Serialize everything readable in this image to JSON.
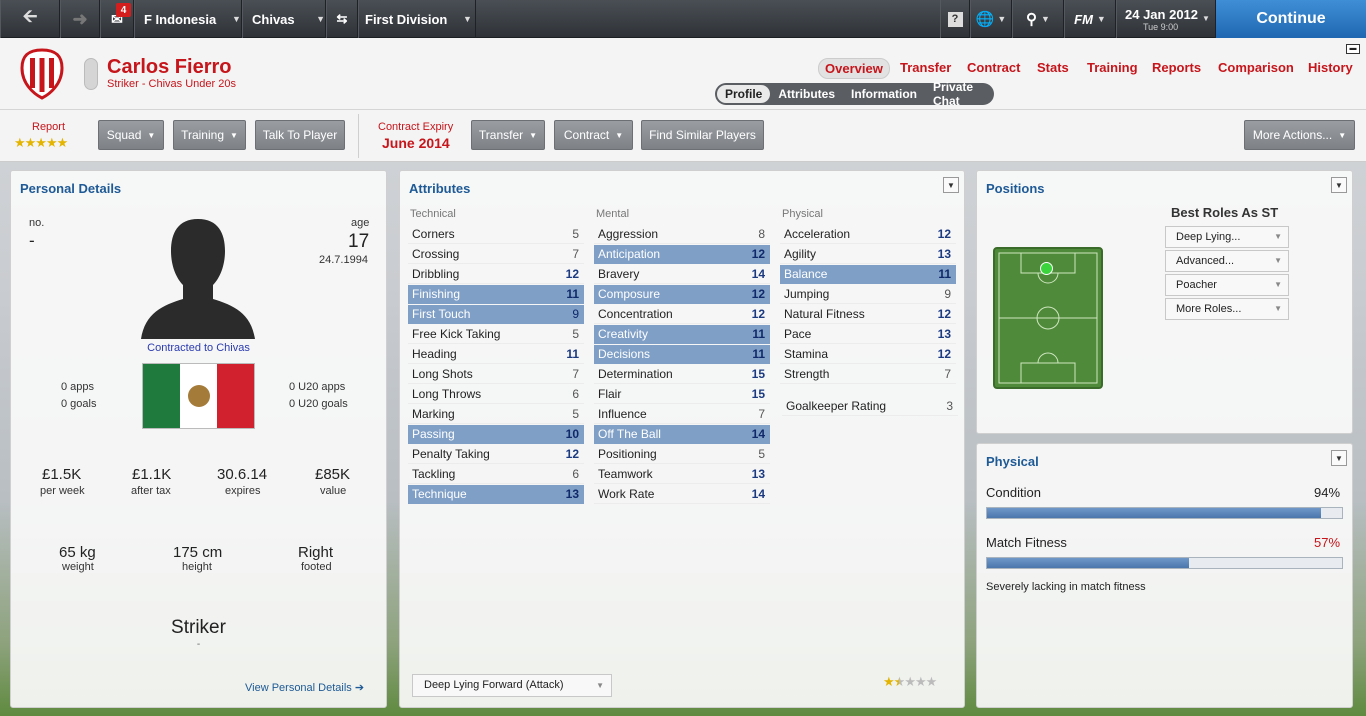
{
  "topbar": {
    "mail_count": "4",
    "nation": "F Indonesia",
    "club": "Chivas",
    "competition": "First Division",
    "date": "24 Jan 2012",
    "day_time": "Tue 9:00",
    "fm_label": "FM",
    "continue_label": "Continue",
    "help_label": "?"
  },
  "header": {
    "name": "Carlos Fierro",
    "subtitle": "Striker - Chivas Under 20s",
    "nav": [
      "Overview",
      "Transfer",
      "Contract",
      "Stats",
      "Training",
      "Reports",
      "Comparison",
      "History"
    ],
    "subnav": [
      "Profile",
      "Attributes",
      "Information",
      "Private Chat"
    ]
  },
  "actionbar": {
    "report_label": "Report",
    "report_stars": "★★★★★",
    "squad": "Squad",
    "training": "Training",
    "talk": "Talk To Player",
    "contract_expiry_label": "Contract Expiry",
    "contract_expiry_value": "June 2014",
    "transfer": "Transfer",
    "contract": "Contract",
    "similar": "Find Similar Players",
    "more": "More Actions..."
  },
  "personal": {
    "title": "Personal Details",
    "no_label": "no.",
    "no_value": "-",
    "age_label": "age",
    "age_value": "17",
    "dob": "24.7.1994",
    "contracted": "Contracted to Chivas",
    "apps": "0 apps",
    "goals": "0 goals",
    "u20_apps": "0 U20 apps",
    "u20_goals": "0 U20 goals",
    "wage": "£1.5K",
    "wage_label": "per week",
    "after_tax": "£1.1K",
    "after_tax_label": "after tax",
    "expires": "30.6.14",
    "expires_label": "expires",
    "value": "£85K",
    "value_label": "value",
    "weight": "65 kg",
    "weight_label": "weight",
    "height": "175 cm",
    "height_label": "height",
    "foot": "Right",
    "foot_label": "footed",
    "position": "Striker",
    "position_sub": "-",
    "view_link": "View Personal Details ➔"
  },
  "attributes": {
    "title": "Attributes",
    "technical_label": "Technical",
    "mental_label": "Mental",
    "physical_label": "Physical",
    "technical": [
      {
        "n": "Corners",
        "v": "5",
        "hl": false
      },
      {
        "n": "Crossing",
        "v": "7",
        "hl": false
      },
      {
        "n": "Dribbling",
        "v": "12",
        "hl": false
      },
      {
        "n": "Finishing",
        "v": "11",
        "hl": true
      },
      {
        "n": "First Touch",
        "v": "9",
        "hl": true
      },
      {
        "n": "Free Kick Taking",
        "v": "5",
        "hl": false
      },
      {
        "n": "Heading",
        "v": "11",
        "hl": false
      },
      {
        "n": "Long Shots",
        "v": "7",
        "hl": false
      },
      {
        "n": "Long Throws",
        "v": "6",
        "hl": false
      },
      {
        "n": "Marking",
        "v": "5",
        "hl": false
      },
      {
        "n": "Passing",
        "v": "10",
        "hl": true
      },
      {
        "n": "Penalty Taking",
        "v": "12",
        "hl": false
      },
      {
        "n": "Tackling",
        "v": "6",
        "hl": false
      },
      {
        "n": "Technique",
        "v": "13",
        "hl": true
      }
    ],
    "mental": [
      {
        "n": "Aggression",
        "v": "8",
        "hl": false
      },
      {
        "n": "Anticipation",
        "v": "12",
        "hl": true
      },
      {
        "n": "Bravery",
        "v": "14",
        "hl": false
      },
      {
        "n": "Composure",
        "v": "12",
        "hl": true
      },
      {
        "n": "Concentration",
        "v": "12",
        "hl": false
      },
      {
        "n": "Creativity",
        "v": "11",
        "hl": true
      },
      {
        "n": "Decisions",
        "v": "11",
        "hl": true
      },
      {
        "n": "Determination",
        "v": "15",
        "hl": false
      },
      {
        "n": "Flair",
        "v": "15",
        "hl": false
      },
      {
        "n": "Influence",
        "v": "7",
        "hl": false
      },
      {
        "n": "Off The Ball",
        "v": "14",
        "hl": true
      },
      {
        "n": "Positioning",
        "v": "5",
        "hl": false
      },
      {
        "n": "Teamwork",
        "v": "13",
        "hl": false
      },
      {
        "n": "Work Rate",
        "v": "14",
        "hl": false
      }
    ],
    "physical": [
      {
        "n": "Acceleration",
        "v": "12",
        "hl": false
      },
      {
        "n": "Agility",
        "v": "13",
        "hl": false
      },
      {
        "n": "Balance",
        "v": "11",
        "hl": true
      },
      {
        "n": "Jumping",
        "v": "9",
        "hl": false
      },
      {
        "n": "Natural Fitness",
        "v": "12",
        "hl": false
      },
      {
        "n": "Pace",
        "v": "13",
        "hl": false
      },
      {
        "n": "Stamina",
        "v": "12",
        "hl": false
      },
      {
        "n": "Strength",
        "v": "7",
        "hl": false
      }
    ],
    "gk_label": "Goalkeeper Rating",
    "gk_value": "3",
    "role_select": "Deep Lying Forward (Attack)",
    "role_stars": 1.5
  },
  "positions": {
    "title": "Positions",
    "best_roles": "Best Roles As ST",
    "roles": [
      "Deep Lying...",
      "Advanced...",
      "Poacher",
      "More Roles..."
    ]
  },
  "physical": {
    "title": "Physical",
    "condition_label": "Condition",
    "condition_value": "94%",
    "condition_pct": 94,
    "fitness_label": "Match Fitness",
    "fitness_value": "57%",
    "fitness_pct": 57,
    "note": "Severely lacking in match fitness"
  },
  "colors": {
    "accent_red": "#c6151b",
    "link_blue": "#1e5a96",
    "highlight": "#7f9fc6",
    "continue_blue": "#2f7cc6"
  }
}
